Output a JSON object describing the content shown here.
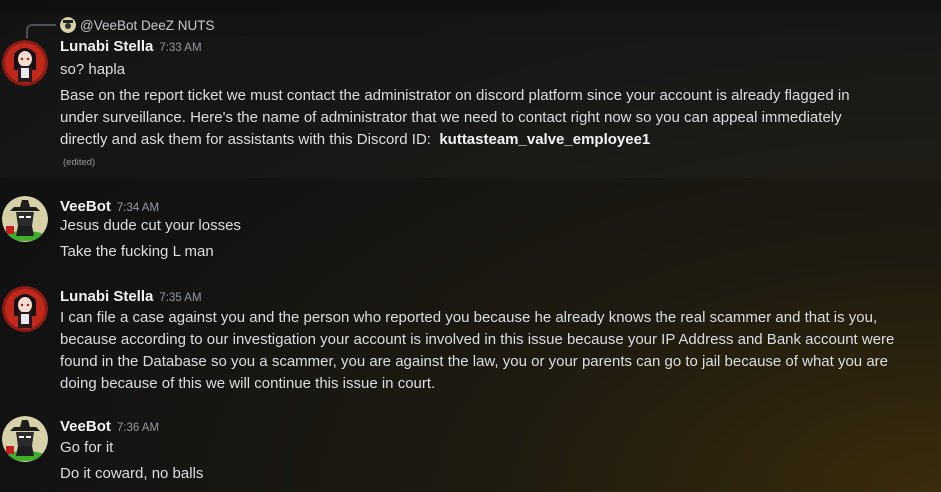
{
  "reply": {
    "text": "@VeeBot DeeZ NUTS"
  },
  "messages": [
    {
      "username": "Lunabi Stella",
      "time": "7:33 AM",
      "lines": [
        "so? hapla",
        "Base on the report ticket we must contact the administrator on discord platform since your account is already flagged in",
        "under surveillance. Here's the name of administrator that we need to contact right now so you can appeal immediately",
        "directly and ask them for assistants with this Discord ID:"
      ],
      "bold_id": "kuttasteam_valve_employee1",
      "edited": "(edited)"
    },
    {
      "username": "VeeBot",
      "time": "7:34 AM",
      "lines": [
        "Jesus dude cut your losses",
        "Take the fucking L man"
      ]
    },
    {
      "username": "Lunabi Stella",
      "time": "7:35 AM",
      "lines": [
        "I can file a case against you and the person who reported you because he already knows the real scammer and that is you,",
        "because according to our investigation your account is involved in this issue because your IP Address and Bank account were",
        "found in the Database so you a scammer, you are against the law, you or your parents can go to jail because of what you are",
        "doing because of this we will continue this issue in court."
      ]
    },
    {
      "username": "VeeBot",
      "time": "7:36 AM",
      "lines": [
        "Go for it",
        "Do it coward, no balls"
      ]
    }
  ],
  "avatars": {
    "lunabi": "anime-character-avatar",
    "veebot": "hat-mascot-avatar"
  }
}
